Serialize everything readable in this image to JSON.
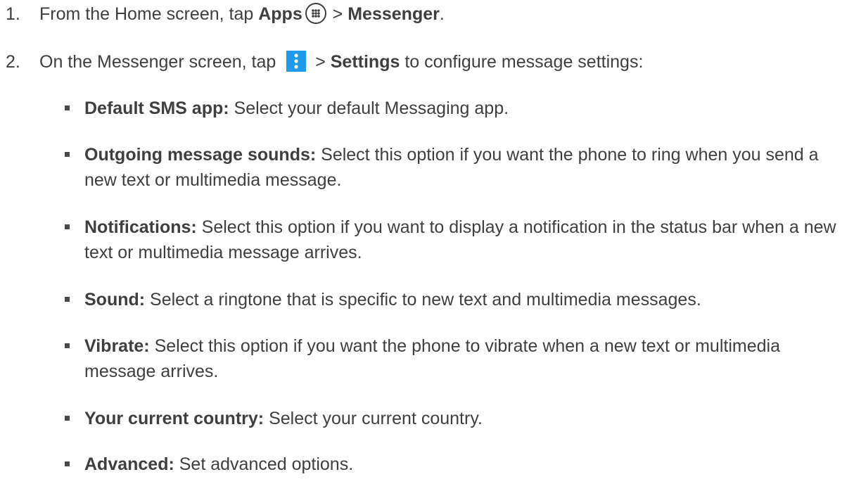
{
  "steps": [
    {
      "number": "1.",
      "pre": "From the Home screen, tap ",
      "apps_label": "Apps",
      "sep": " > ",
      "target": "Messenger",
      "end": "."
    },
    {
      "number": "2.",
      "pre": "On the Messenger screen, tap ",
      "sep": " > ",
      "target": "Settings",
      "post": " to configure message settings:"
    }
  ],
  "settings": [
    {
      "term": "Default SMS app:",
      "desc": " Select your default Messaging app."
    },
    {
      "term": "Outgoing message sounds:",
      "desc": " Select this option if you want the phone to ring when you send a new text or multimedia message."
    },
    {
      "term": "Notifications:",
      "desc": " Select this option if you want to display a notification in the status bar when a new text or multimedia message arrives."
    },
    {
      "term": "Sound:",
      "desc": " Select a ringtone that is specific to new text and multimedia messages."
    },
    {
      "term": "Vibrate:",
      "desc": " Select this option if you want the phone to vibrate when a new text or multimedia message arrives."
    },
    {
      "term": "Your current country:",
      "desc": " Select your current country."
    },
    {
      "term": "Advanced:",
      "desc": " Set advanced options."
    }
  ],
  "icons": {
    "apps": "apps-grid-icon",
    "menu": "overflow-menu-icon",
    "menu_color": "#1e9ae8"
  }
}
